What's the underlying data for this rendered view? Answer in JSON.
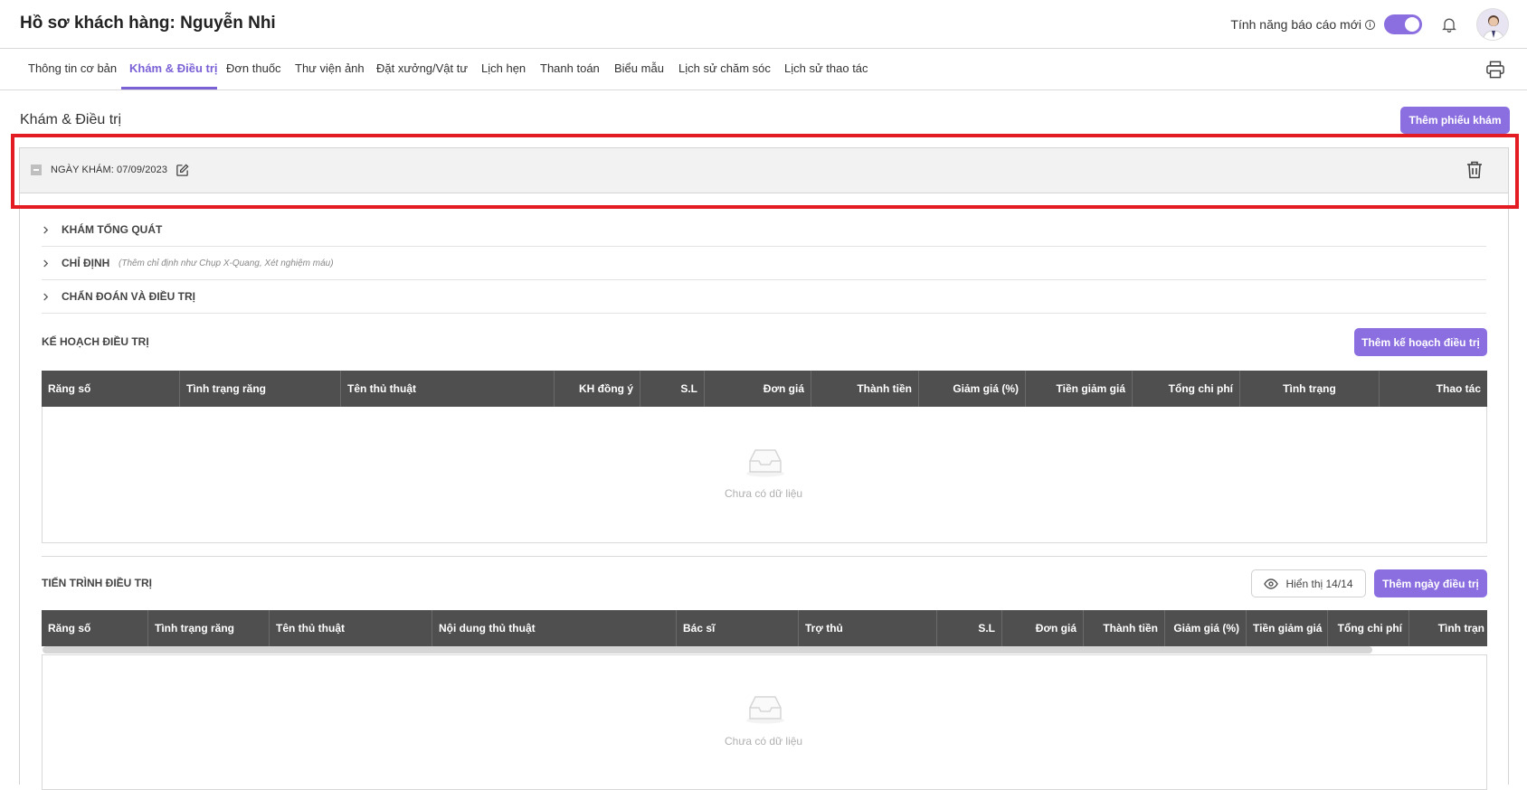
{
  "header": {
    "title": "Hồ sơ khách hàng: Nguyễn Nhi",
    "report_toggle_label": "Tính năng báo cáo mới",
    "report_toggle_on": true
  },
  "tabs": [
    {
      "label": "Thông tin cơ bản",
      "active": false
    },
    {
      "label": "Khám & Điều trị",
      "active": true
    },
    {
      "label": "Đơn thuốc",
      "active": false
    },
    {
      "label": "Thư viện ảnh",
      "active": false
    },
    {
      "label": "Đặt xưởng/Vật tư",
      "active": false
    },
    {
      "label": "Lịch hẹn",
      "active": false
    },
    {
      "label": "Thanh toán",
      "active": false
    },
    {
      "label": "Biểu mẫu",
      "active": false
    },
    {
      "label": "Lịch sử chăm sóc",
      "active": false
    },
    {
      "label": "Lịch sử thao tác",
      "active": false
    }
  ],
  "main": {
    "section_title": "Khám & Điều trị",
    "add_exam_button": "Thêm phiếu khám",
    "exam": {
      "date_label": "NGÀY KHÁM: 07/09/2023",
      "accordion": [
        {
          "label": "KHÁM TỔNG QUÁT",
          "hint": ""
        },
        {
          "label": "CHỈ ĐỊNH",
          "hint": "(Thêm chỉ định như Chụp X-Quang, Xét nghiệm máu)"
        },
        {
          "label": "CHẨN ĐOÁN VÀ ĐIỀU TRỊ",
          "hint": ""
        }
      ],
      "plan": {
        "title": "KẾ HOẠCH ĐIỀU TRỊ",
        "add_button": "Thêm kế hoạch điều trị",
        "columns": [
          "Răng số",
          "Tình trạng răng",
          "Tên thủ thuật",
          "KH đồng ý",
          "S.L",
          "Đơn giá",
          "Thành tiền",
          "Giảm giá (%)",
          "Tiền giảm giá",
          "Tổng chi phí",
          "Tình trạng",
          "Thao tác"
        ],
        "empty_text": "Chưa có dữ liệu"
      },
      "progress": {
        "title": "TIẾN TRÌNH ĐIỀU TRỊ",
        "show_button": "Hiển thị 14/14",
        "add_button": "Thêm ngày điều trị",
        "columns": [
          "Răng số",
          "Tình trạng răng",
          "Tên thủ thuật",
          "Nội dung thủ thuật",
          "Bác sĩ",
          "Trợ thủ",
          "S.L",
          "Đơn giá",
          "Thành tiền",
          "Giảm giá (%)",
          "Tiền giảm giá",
          "Tổng chi phí",
          "Tình trạn"
        ],
        "empty_text": "Chưa có dữ liệu"
      }
    }
  },
  "colors": {
    "accent": "#8b6fe0",
    "table_header": "#4f4f4f",
    "highlight": "#e31b23"
  }
}
